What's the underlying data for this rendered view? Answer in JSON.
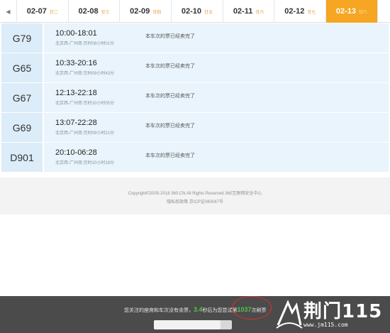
{
  "date_nav": {
    "prev_icon": "triangle-left-icon",
    "dates": [
      {
        "date": "02-07",
        "lunar": "廿二",
        "active": false
      },
      {
        "date": "02-08",
        "lunar": "廿三",
        "active": false
      },
      {
        "date": "02-09",
        "lunar": "廿四",
        "active": false
      },
      {
        "date": "02-10",
        "lunar": "廿五",
        "active": false
      },
      {
        "date": "02-11",
        "lunar": "廿六",
        "active": false
      },
      {
        "date": "02-12",
        "lunar": "廿七",
        "active": false
      },
      {
        "date": "02-13",
        "lunar": "廿八",
        "active": true
      }
    ],
    "active_color": "#f6a623"
  },
  "trains": [
    {
      "number": "G79",
      "time": "10:00-18:01",
      "route": "北京西-广州南 历时08小时01分",
      "status": "本车次的票已经卖完了"
    },
    {
      "number": "G65",
      "time": "10:33-20:16",
      "route": "北京西-广州南 历时09小时43分",
      "status": "本车次的票已经卖完了"
    },
    {
      "number": "G67",
      "time": "12:13-22:18",
      "route": "北京西-广州南 历时10小时05分",
      "status": "本车次的票已经卖完了"
    },
    {
      "number": "G69",
      "time": "13:07-22:28",
      "route": "北京西-广州南 历时09小时21分",
      "status": "本车次的票已经卖完了"
    },
    {
      "number": "D901",
      "time": "20:10-06:28",
      "route": "北京西-广州南 历时10小时18分",
      "status": "本车次的票已经卖完了"
    }
  ],
  "footer": {
    "copyright": "Copyright©2005-2018 360.CN All Rights Reserved 360互联网安全中心",
    "icp": "隐私权政策 京ICP证080047号"
  },
  "bottom_bar": {
    "tip_prefix": "您关注的座席和车次没有余票，",
    "seconds": "3.4",
    "tip_middle": "秒后为您尝试第",
    "attempt_count": "1037",
    "tip_suffix": "次刷票",
    "progress": 0.85
  },
  "logo": {
    "text": "荆门115",
    "url": "www.jm115.com"
  }
}
